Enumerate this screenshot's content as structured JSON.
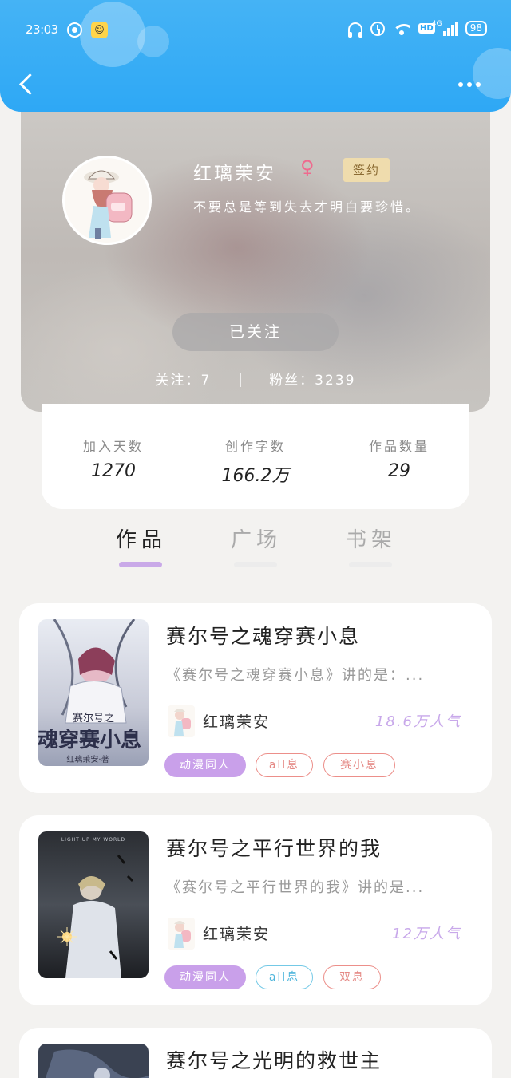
{
  "status_bar": {
    "time": "23:03",
    "battery": "98",
    "network": "4G",
    "hd": "HD"
  },
  "nav": {
    "back_label": "",
    "more_label": ""
  },
  "profile": {
    "name": "红璃茉安",
    "gender_symbol": "♀",
    "badge": "签约",
    "bio": "不要总是等到失去才明白要珍惜。",
    "follow_button": "已关注",
    "following_label": "关注：7",
    "fans_label": "粉丝：3239"
  },
  "stats": [
    {
      "label": "加入天数",
      "value": "1270"
    },
    {
      "label": "创作字数",
      "value": "166.2万"
    },
    {
      "label": "作品数量",
      "value": "29"
    }
  ],
  "tabs": [
    {
      "label": "作品",
      "active": true
    },
    {
      "label": "广场",
      "active": false
    },
    {
      "label": "书架",
      "active": false
    }
  ],
  "books": [
    {
      "title": "赛尔号之魂穿赛小息",
      "desc": "《赛尔号之魂穿赛小息》讲的是：...",
      "author": "红璃茉安",
      "popularity": "18.6万人气",
      "cover_text": "魂穿赛小息",
      "cover_sub": "赛尔号之",
      "cover_author": "红璃茉安·著",
      "tags": [
        {
          "label": "动漫同人",
          "style": "fill"
        },
        {
          "label": "all息",
          "style": "red"
        },
        {
          "label": "赛小息",
          "style": "red"
        }
      ]
    },
    {
      "title": "赛尔号之平行世界的我",
      "desc": "《赛尔号之平行世界的我》讲的是...",
      "author": "红璃茉安",
      "popularity": "12万人气",
      "cover_text": "LIGHT UP MY WORLD",
      "tags": [
        {
          "label": "动漫同人",
          "style": "fill"
        },
        {
          "label": "all息",
          "style": "blue"
        },
        {
          "label": "双息",
          "style": "red"
        }
      ]
    },
    {
      "title": "赛尔号之光明的救世主"
    }
  ]
}
